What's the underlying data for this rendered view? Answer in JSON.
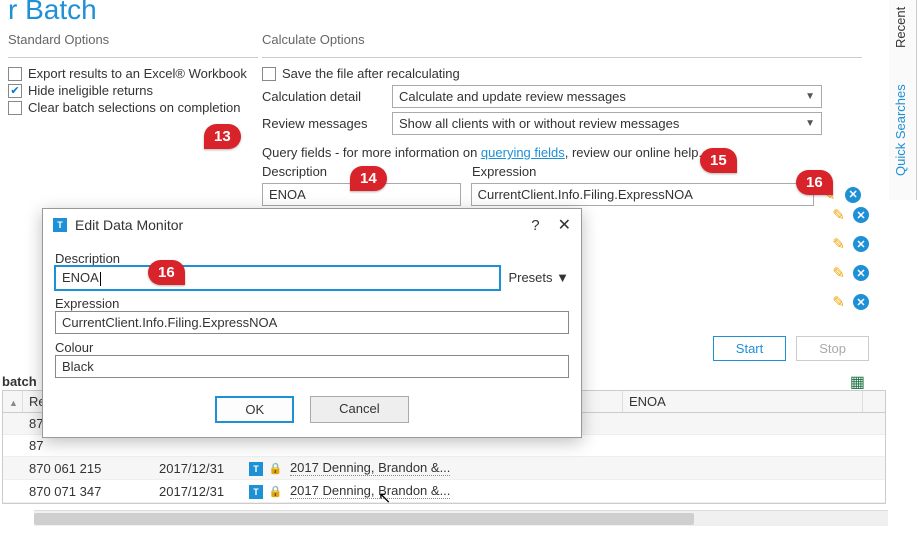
{
  "header_fragment": "r Batch",
  "standard_options": {
    "title": "Standard Options",
    "export": "Export results to an Excel® Workbook",
    "hide": "Hide ineligible returns",
    "clear": "Clear batch selections on completion"
  },
  "calc_options": {
    "title": "Calculate Options",
    "save": "Save the file after recalculating",
    "detail_label": "Calculation detail",
    "detail_value": "Calculate and update review messages",
    "review_label": "Review messages",
    "review_value": "Show all clients with or without review messages"
  },
  "query": {
    "help_prefix": "Query fields - for more information on ",
    "help_link": "querying fields",
    "help_suffix": ", review our online help.",
    "desc_header": "Description",
    "expr_header": "Expression",
    "desc_value": "ENOA",
    "expr_value": "CurrentClient.Info.Filing.ExpressNOA"
  },
  "buttons": {
    "start": "Start",
    "stop": "Stop"
  },
  "side_tabs": {
    "recent": "Recent",
    "quick": "Quick Searches"
  },
  "batch_label": "batch",
  "table": {
    "cols": {
      "c1": "",
      "c2": "Re",
      "c3": "",
      "c4": "",
      "c5": "ENOA"
    },
    "rows": [
      {
        "c2": "87"
      },
      {
        "c2": "87"
      },
      {
        "c2": "870 061 215",
        "c3": "2017/12/31",
        "name": "2017 Denning, Brandon &..."
      },
      {
        "c2": "870 071 347",
        "c3": "2017/12/31",
        "name": "2017 Denning, Brandon &..."
      }
    ]
  },
  "dialog": {
    "title": "Edit Data Monitor",
    "desc_label": "Description",
    "desc_value": "ENOA",
    "presets": "Presets  ▼",
    "expr_label": "Expression",
    "expr_value": "CurrentClient.Info.Filing.ExpressNOA",
    "colour_label": "Colour",
    "colour_value": "Black",
    "ok": "OK",
    "cancel": "Cancel"
  },
  "callouts": {
    "c13": "13",
    "c14": "14",
    "c15": "15",
    "c16a": "16",
    "c16b": "16"
  }
}
